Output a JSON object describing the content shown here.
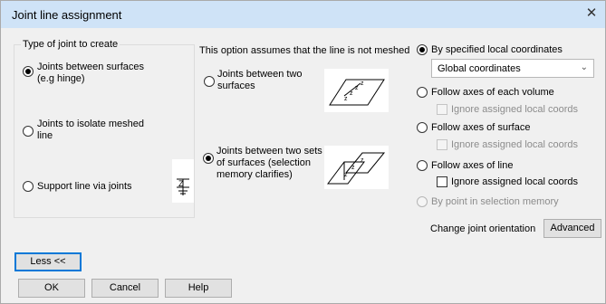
{
  "window": {
    "title": "Joint line assignment",
    "close_glyph": "✕"
  },
  "joint_type": {
    "group_label": "Type of joint to create",
    "opt_surfaces": "Joints between surfaces\n(e.g hinge)",
    "opt_isolate": "Joints to isolate meshed\nline",
    "opt_support": "Support line via joints"
  },
  "mesh": {
    "note": "This option assumes that the line is not meshed",
    "opt_two_surfaces": "Joints between two\nsurfaces",
    "opt_two_sets": "Joints between two sets\nof surfaces (selection\nmemory clarifies)"
  },
  "coords": {
    "opt_local": "By specified local coordinates",
    "select_value": "Global coordinates",
    "opt_volume": "Follow axes of each volume",
    "ignore_volume": "Ignore assigned local coords",
    "opt_surface": "Follow axes of surface",
    "ignore_surface": "Ignore assigned local coords",
    "opt_line": "Follow axes of line",
    "ignore_line": "Ignore assigned local coords",
    "opt_point": "By point in selection memory",
    "orientation_label": "Change joint orientation",
    "advanced_button": "Advanced"
  },
  "footer": {
    "less_button": "Less <<",
    "ok_button": "OK",
    "cancel_button": "Cancel",
    "help_button": "Help"
  }
}
